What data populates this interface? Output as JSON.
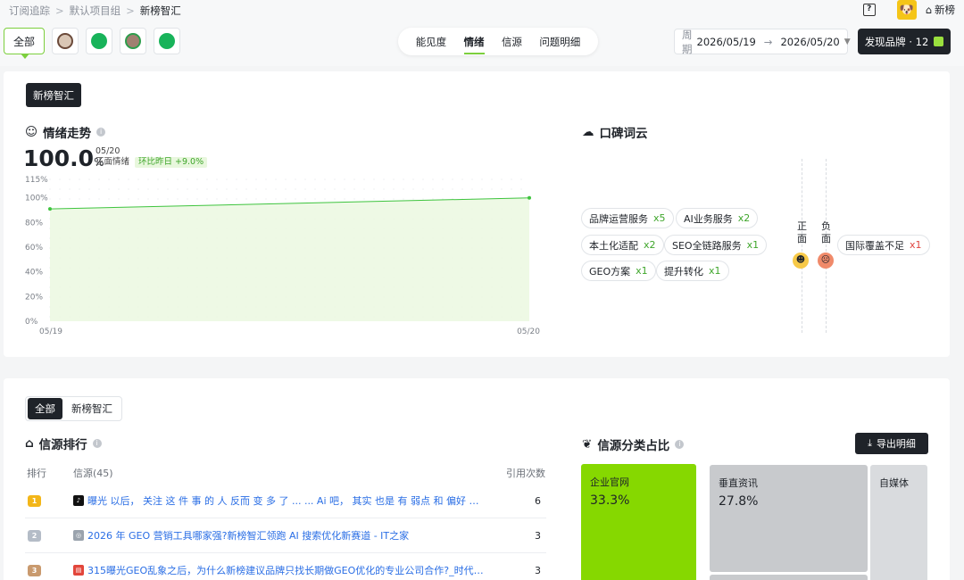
{
  "breadcrumb": [
    "订阅追踪",
    "默认项目组",
    "新榜智汇"
  ],
  "header": {
    "help_icon": "?",
    "home_label": "新榜"
  },
  "brand_tabs": {
    "all_label": "全部"
  },
  "view_tabs": [
    "能见度",
    "情绪",
    "信源",
    "问题明细"
  ],
  "period": {
    "label": "周期",
    "start": "2026/05/19",
    "end": "2026/05/20"
  },
  "discover_button": "发现品牌 · 12",
  "brand_chip": "新榜智汇",
  "sentiment": {
    "title": "情绪走势",
    "value": "100.0",
    "unit": "%",
    "date": "05/20",
    "label": "正面情绪",
    "delta": "环比昨日 +9.0%"
  },
  "chart_data": {
    "type": "area",
    "x": [
      "05/19",
      "05/20"
    ],
    "series": [
      {
        "values": [
          91,
          100
        ]
      }
    ],
    "y_ticks": [
      "0%",
      "20%",
      "40%",
      "60%",
      "80%",
      "100%",
      "115%"
    ],
    "ylim": [
      0,
      115
    ],
    "grid": "dotted",
    "colors": {
      "line": "#3ec43e",
      "fill": "#eaf8df"
    }
  },
  "wordcloud": {
    "title": "口碑词云",
    "positive_label": "正面",
    "negative_label": "负面",
    "positive": [
      {
        "text": "品牌运营服务",
        "count": "x5"
      },
      {
        "text": "AI业务服务",
        "count": "x2"
      },
      {
        "text": "本土化适配",
        "count": "x2"
      },
      {
        "text": "SEO全链路服务",
        "count": "x1"
      },
      {
        "text": "GEO方案",
        "count": "x1"
      },
      {
        "text": "提升转化",
        "count": "x1"
      }
    ],
    "negative": [
      {
        "text": "国际覆盖不足",
        "count": "x1"
      }
    ]
  },
  "source_filter": [
    "全部",
    "新榜智汇"
  ],
  "source_rank": {
    "title": "信源排行",
    "col_rank": "排行",
    "col_source": "信源(45)",
    "col_count": "引用次数",
    "rows": [
      {
        "rank": "1",
        "title": "曝光 以后， 关注 这 件 事 的 人 反而 变 多 了 ... ... Ai 吧， 其实 也是 有 弱点 和 偏好 的 ...",
        "count": "6"
      },
      {
        "rank": "2",
        "title": "2026 年 GEO 营销工具哪家强?新榜智汇领跑 AI 搜索优化新赛道 - IT之家",
        "count": "3"
      },
      {
        "rank": "3",
        "title": "315曝光GEO乱象之后，为什么新榜建议品牌只找长期做GEO优化的专业公司合作?_时代报告网",
        "count": "3"
      }
    ]
  },
  "source_type": {
    "title": "信源分类占比",
    "export_label": "导出明细",
    "items": [
      {
        "name": "企业官网",
        "value": "33.3%"
      },
      {
        "name": "垂直资讯",
        "value": "27.8%"
      },
      {
        "name": "自媒体",
        "value": ""
      }
    ]
  }
}
